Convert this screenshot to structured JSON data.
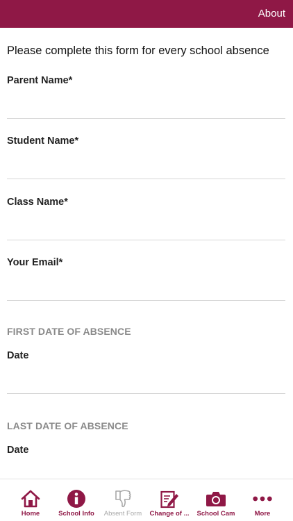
{
  "header": {
    "about_label": "About"
  },
  "form": {
    "intro": "Please complete this form for every school absence",
    "parent_name_label": "Parent Name*",
    "student_name_label": "Student Name*",
    "class_name_label": "Class Name*",
    "email_label": "Your Email*",
    "first_date_header": "FIRST DATE OF ABSENCE",
    "first_date_label": "Date",
    "last_date_header": "LAST DATE OF ABSENCE",
    "last_date_label": "Date"
  },
  "tabs": [
    {
      "label": "Home",
      "icon": "home-icon",
      "active": true
    },
    {
      "label": "School Info",
      "icon": "info-icon",
      "active": true
    },
    {
      "label": "Absent Form",
      "icon": "thumbs-down-icon",
      "active": false
    },
    {
      "label": "Change of ...",
      "icon": "edit-icon",
      "active": true
    },
    {
      "label": "School Cam",
      "icon": "camera-icon",
      "active": true
    },
    {
      "label": "More",
      "icon": "more-icon",
      "active": true
    }
  ],
  "colors": {
    "brand": "#8f1846",
    "inactive": "#a8a8a8",
    "section_header": "#8a8a8a"
  }
}
